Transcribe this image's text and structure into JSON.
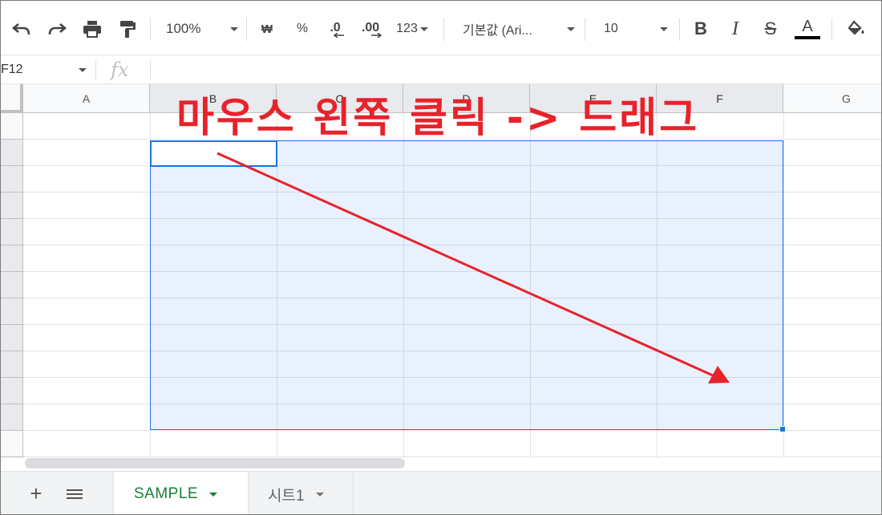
{
  "toolbar": {
    "undo_icon": "undo-icon",
    "redo_icon": "redo-icon",
    "print_icon": "print-icon",
    "paint_format_icon": "paint-format-icon",
    "zoom": "100%",
    "currency": "₩",
    "percent": "%",
    "dec_decrease": ".0",
    "dec_increase": ".00",
    "number_format": "123",
    "font_family": "기본값 (Ari...",
    "font_size": "10",
    "bold": "B",
    "italic": "I",
    "strike": "S",
    "text_color_letter": "A",
    "text_color": "#000000",
    "fill_icon": "fill-color-icon"
  },
  "formula_bar": {
    "name_box": "F12",
    "fx": "fx",
    "value": ""
  },
  "grid": {
    "columns": [
      "A",
      "B",
      "C",
      "D",
      "E",
      "F",
      "G"
    ],
    "selected_columns": [
      "B",
      "C",
      "D",
      "E",
      "F"
    ],
    "active_cell": "B",
    "selection_color": "#1a73e8"
  },
  "annotation": {
    "text": "마우스 왼쪽 클릭 -> 드래그",
    "color": "#e8222b"
  },
  "sheets": {
    "add_label": "+",
    "tabs": [
      {
        "label": "SAMPLE",
        "active": true
      },
      {
        "label": "시트1",
        "active": false
      }
    ],
    "active_color": "#188038"
  }
}
